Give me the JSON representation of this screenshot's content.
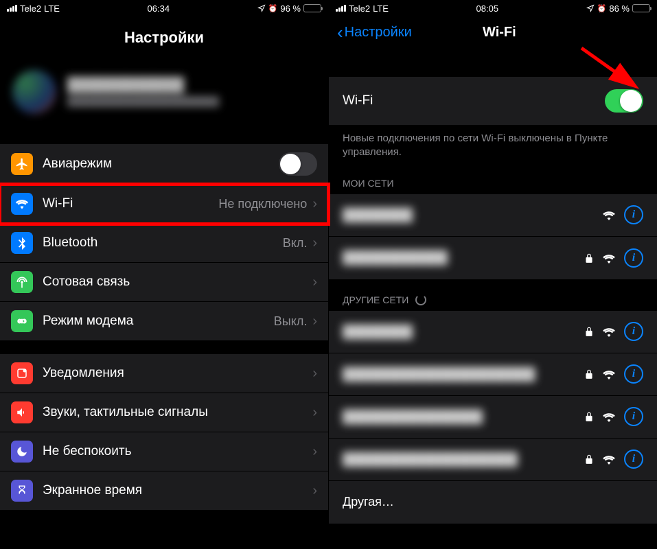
{
  "left": {
    "status": {
      "carrier": "Tele2",
      "net": "LTE",
      "time": "06:34",
      "alarm_glyph": "⏰",
      "battery_pct": "96 %",
      "battery_fill": 96
    },
    "title": "Настройки",
    "profile": {
      "name": "████████████",
      "sub": "████████████████████████"
    },
    "rows": {
      "airplane": {
        "label": "Авиарежим",
        "toggle": "off"
      },
      "wifi": {
        "label": "Wi-Fi",
        "value": "Не подключено"
      },
      "bt": {
        "label": "Bluetooth",
        "value": "Вкл."
      },
      "cell": {
        "label": "Сотовая связь"
      },
      "hotspot": {
        "label": "Режим модема",
        "value": "Выкл."
      },
      "notif": {
        "label": "Уведомления"
      },
      "sounds": {
        "label": "Звуки, тактильные сигналы"
      },
      "dnd": {
        "label": "Не беспокоить"
      },
      "screentime": {
        "label": "Экранное время"
      }
    }
  },
  "right": {
    "status": {
      "carrier": "Tele2",
      "net": "LTE",
      "time": "08:05",
      "alarm_glyph": "⏰",
      "battery_pct": "86 %",
      "battery_fill": 86
    },
    "back": "Настройки",
    "title": "Wi-Fi",
    "wifi_label": "Wi-Fi",
    "wifi_toggle": "on",
    "footnote": "Новые подключения по сети Wi-Fi выключены в Пункте управления.",
    "my_networks_header": "МОИ СЕТИ",
    "my_networks": [
      {
        "name": "████████",
        "locked": false
      },
      {
        "name": "████████████",
        "locked": true
      }
    ],
    "other_networks_header": "ДРУГИЕ СЕТИ",
    "other_networks": [
      {
        "name": "████████",
        "locked": true
      },
      {
        "name": "██████████████████████",
        "locked": true
      },
      {
        "name": "████████████████",
        "locked": true
      },
      {
        "name": "████████████████████",
        "locked": true
      }
    ],
    "other_label": "Другая…"
  }
}
